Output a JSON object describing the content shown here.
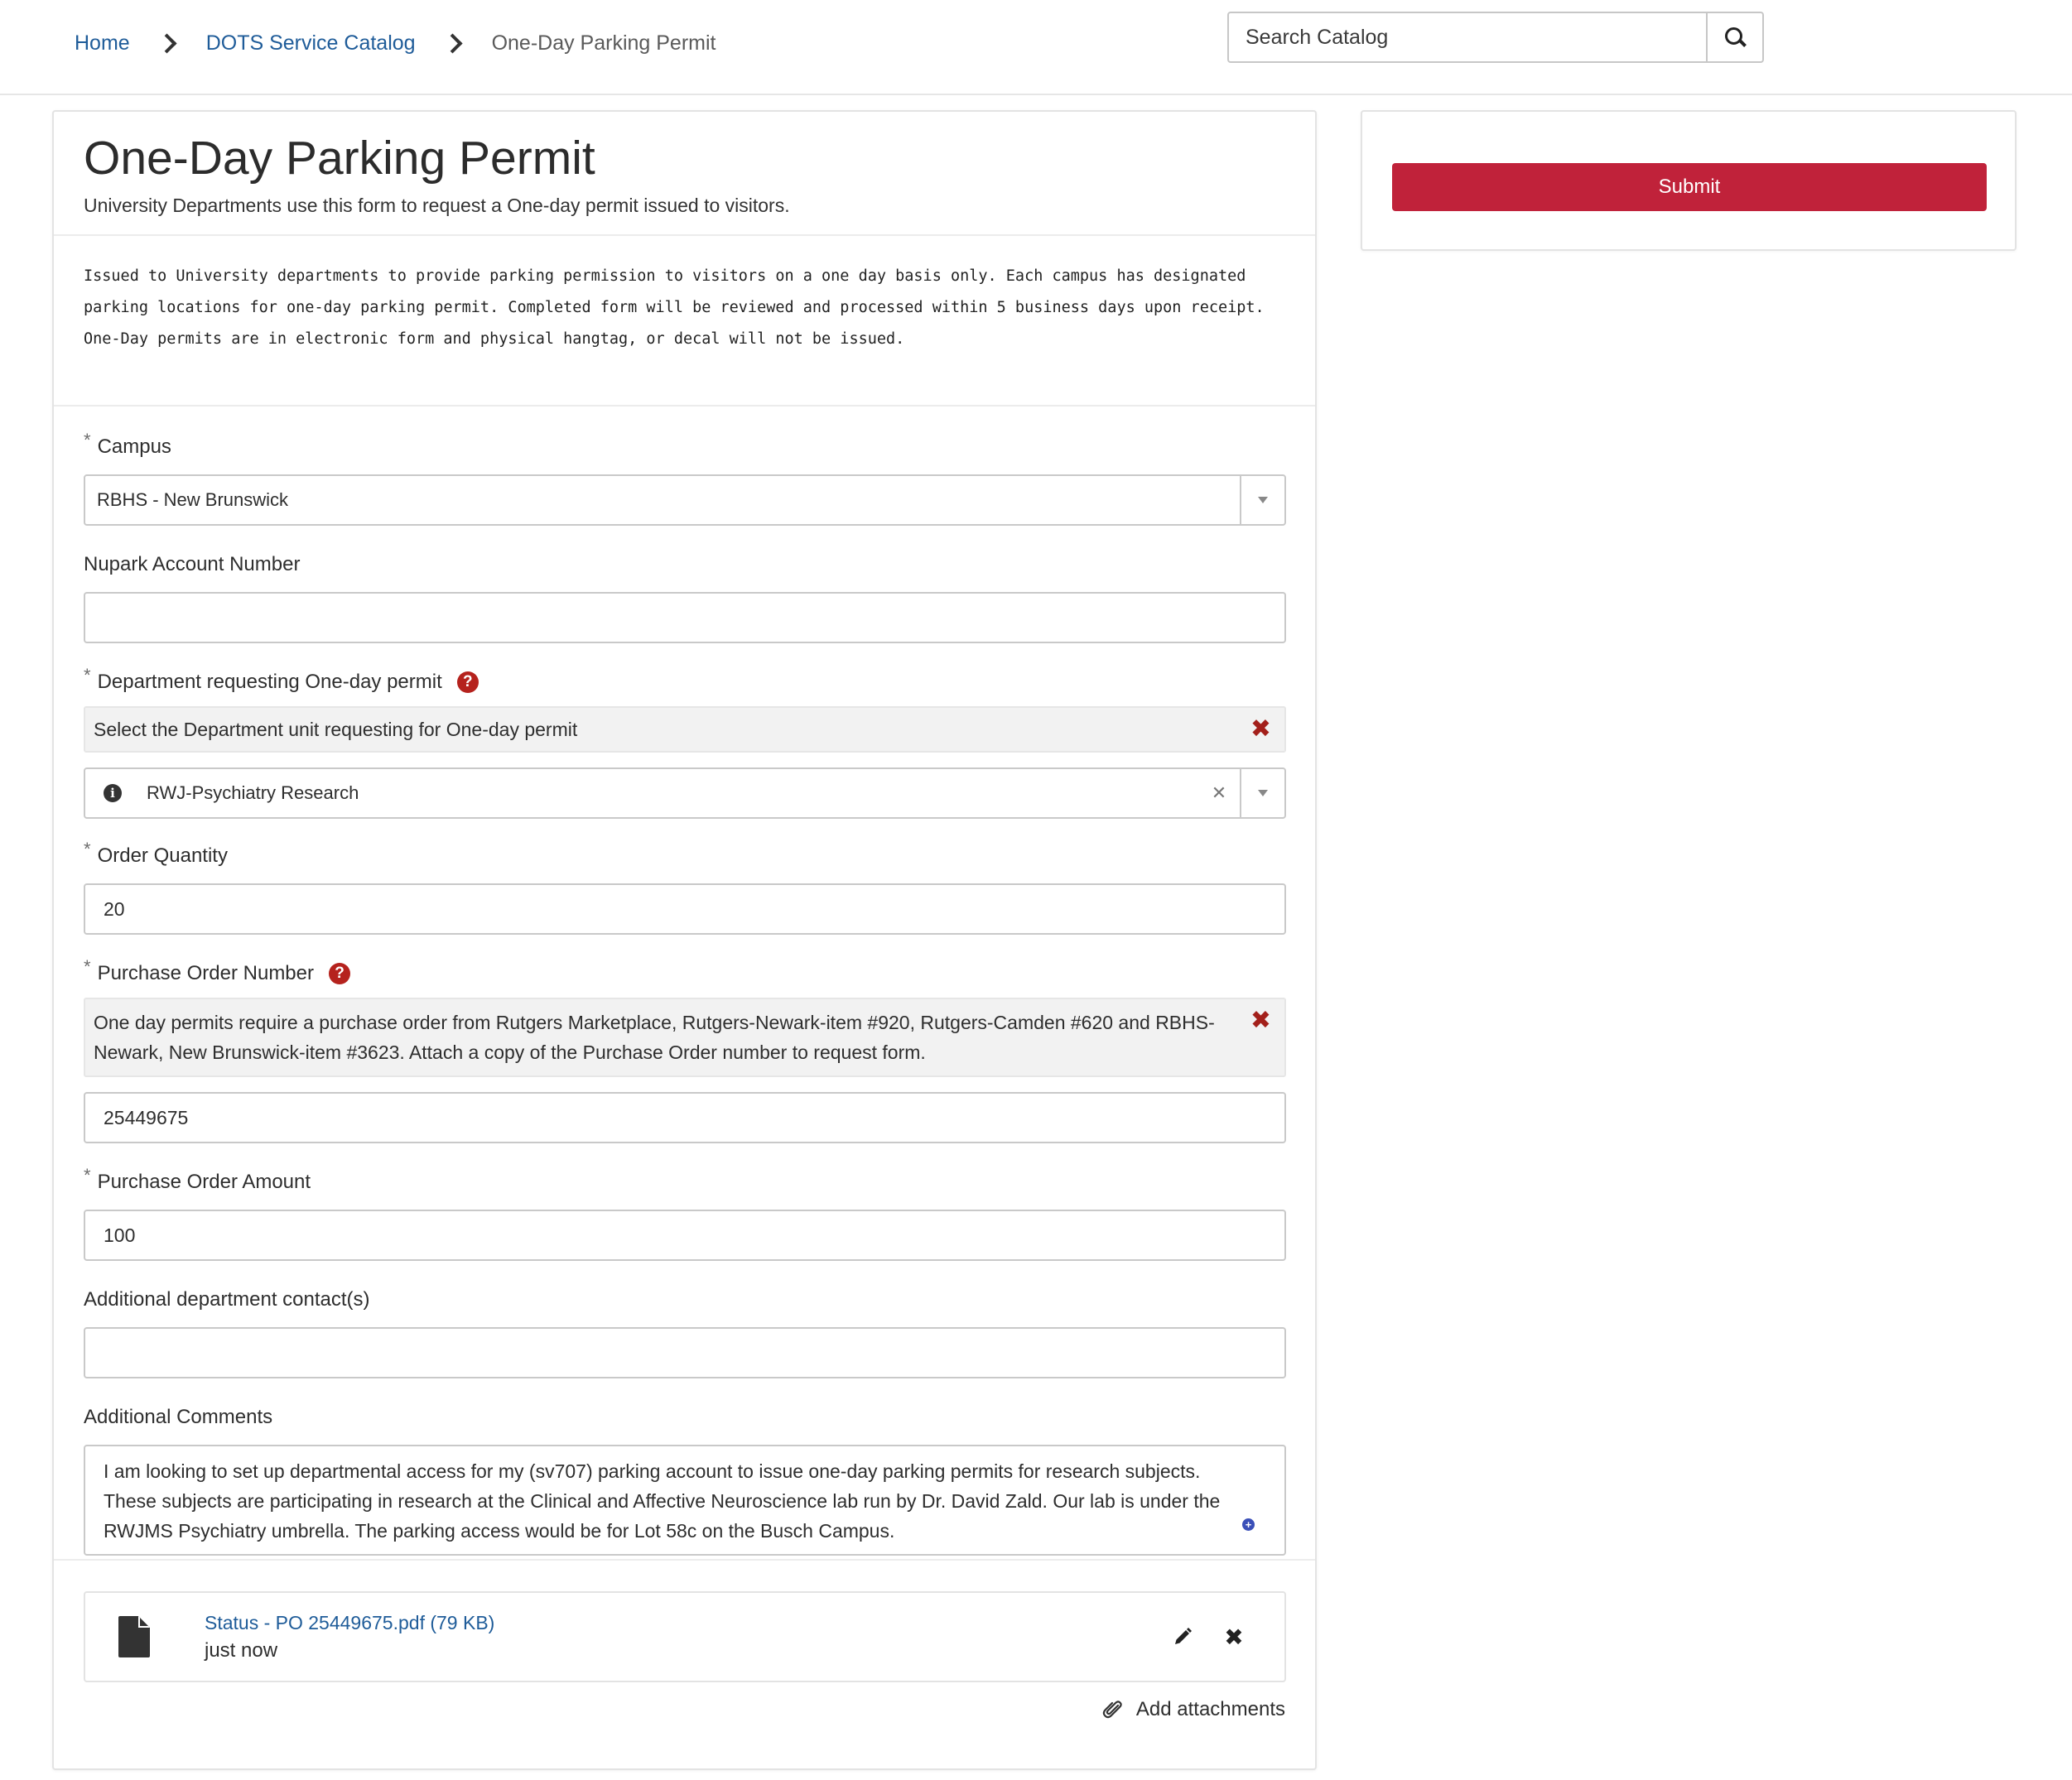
{
  "breadcrumb": {
    "items": [
      "Home",
      "DOTS Service Catalog"
    ],
    "current": "One-Day Parking Permit"
  },
  "search": {
    "placeholder": "Search Catalog",
    "value": ""
  },
  "page": {
    "title": "One-Day Parking Permit",
    "subtitle": "University Departments use this form to request a One-day permit issued to visitors.",
    "description": "Issued to University departments to provide parking permission to visitors on a one day basis only. Each campus has designated parking locations for one-day parking permit.  Completed form will be reviewed and processed within 5 business days upon receipt. One-Day permits are in electronic form and physical hangtag, or decal will not be issued."
  },
  "form": {
    "campus": {
      "label": "Campus",
      "value": "RBHS - New Brunswick"
    },
    "nupark": {
      "label": "Nupark Account Number",
      "value": ""
    },
    "department": {
      "label": "Department requesting One-day permit",
      "hint": "Select the Department unit requesting for One-day permit",
      "value": "RWJ-Psychiatry Research"
    },
    "quantity": {
      "label": "Order Quantity",
      "value": "20"
    },
    "po_number": {
      "label": "Purchase Order Number",
      "hint": "One day permits require a purchase order from Rutgers Marketplace, Rutgers-Newark-item #920, Rutgers-Camden #620 and RBHS-Newark, New Brunswick-item #3623. Attach a copy of the Purchase Order number to request form.",
      "value": "25449675"
    },
    "po_amount": {
      "label": "Purchase Order Amount",
      "value": "100"
    },
    "contacts": {
      "label": "Additional department contact(s)",
      "value": ""
    },
    "comments": {
      "label": "Additional Comments",
      "value": "I am looking to set up departmental access for my (sv707) parking account to issue one-day parking permits for research subjects. These subjects are participating in research at the Clinical and Affective Neuroscience lab run by Dr. David Zald. Our lab is under the RWJMS Psychiatry umbrella. The parking access would be for Lot 58c on the Busch Campus."
    }
  },
  "attachment": {
    "file_name": "Status - PO 25449675.pdf (79 KB)",
    "time": "just now",
    "add_label": "Add attachments"
  },
  "sidebar": {
    "submit_label": "Submit"
  },
  "colors": {
    "link": "#1f5c99",
    "submit": "#c0223a",
    "help": "#b5221d"
  }
}
